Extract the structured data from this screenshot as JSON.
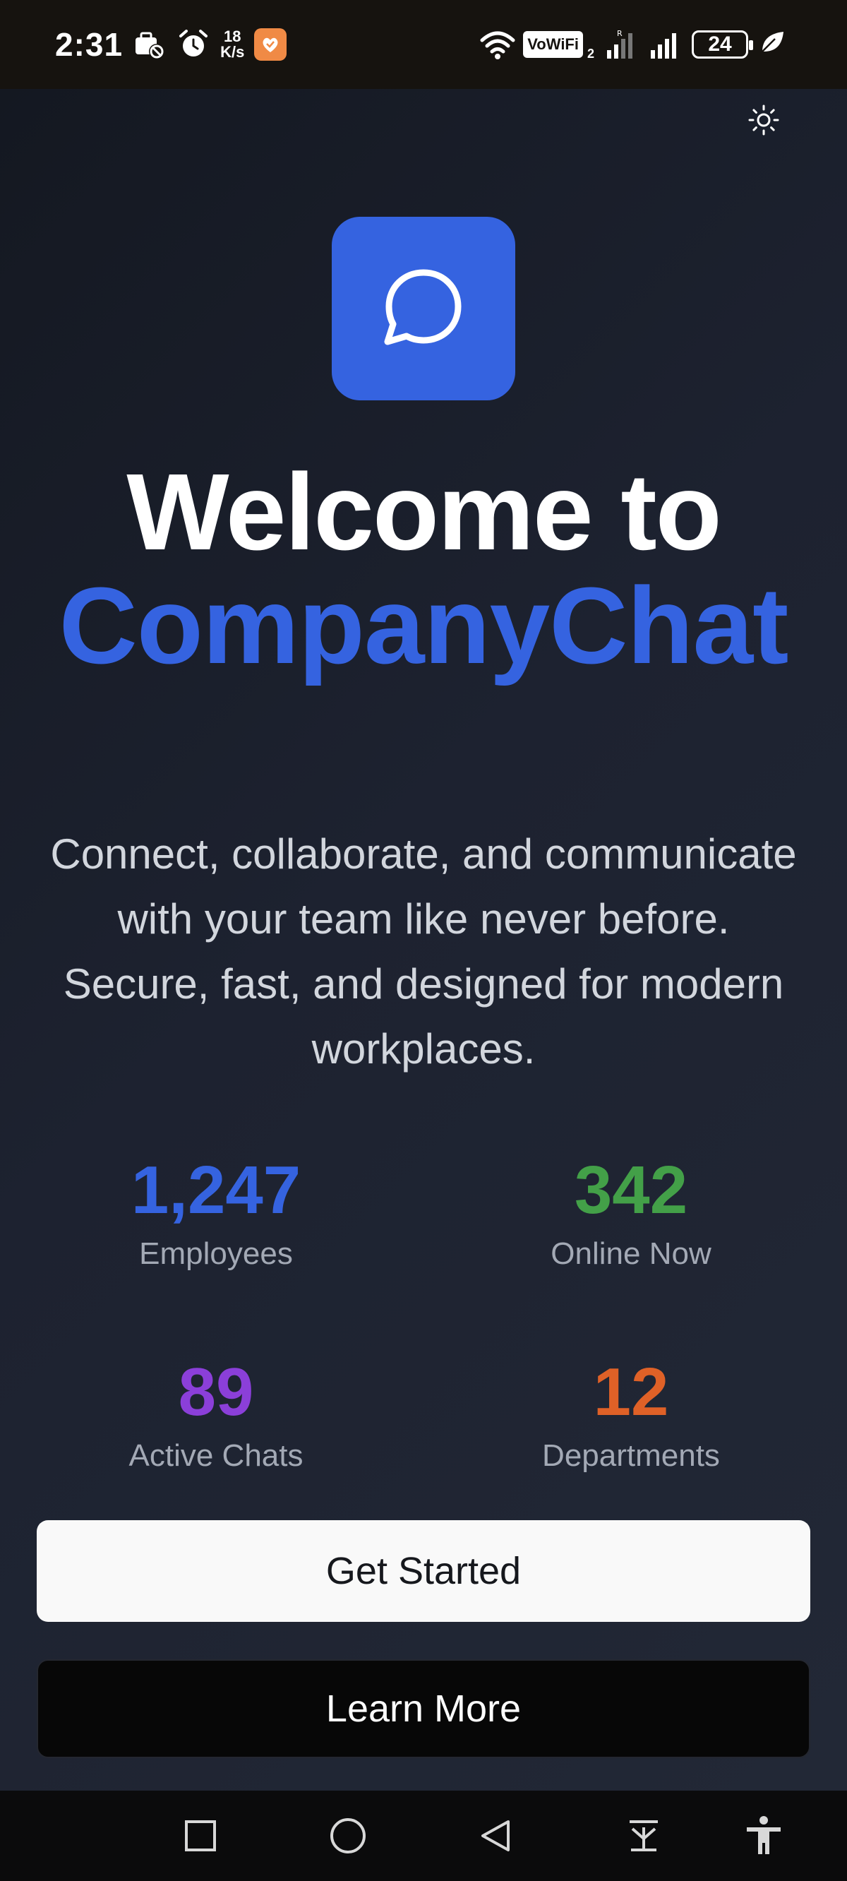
{
  "status_bar": {
    "time": "2:31",
    "net_speed_value": "18",
    "net_speed_unit": "K/s",
    "vowifi": "VoWiFi",
    "vowifi_sim": "2",
    "battery": "24"
  },
  "hero": {
    "welcome": "Welcome to",
    "brand": "CompanyChat",
    "tagline": "Connect, collaborate, and communicate with your team like never before. Secure, fast, and designed for modern workplaces."
  },
  "stats": [
    {
      "value": "1,247",
      "label": "Employees",
      "color": "#3563e0"
    },
    {
      "value": "342",
      "label": "Online Now",
      "color": "#43a048"
    },
    {
      "value": "89",
      "label": "Active Chats",
      "color": "#8b3fd9"
    },
    {
      "value": "12",
      "label": "Departments",
      "color": "#df6127"
    }
  ],
  "actions": {
    "primary": "Get Started",
    "secondary": "Learn More"
  },
  "colors": {
    "accent": "#3563e0",
    "background": "#1d2230"
  },
  "icons": {
    "theme_toggle": "sun-icon",
    "logo": "chat-bubble-icon"
  }
}
